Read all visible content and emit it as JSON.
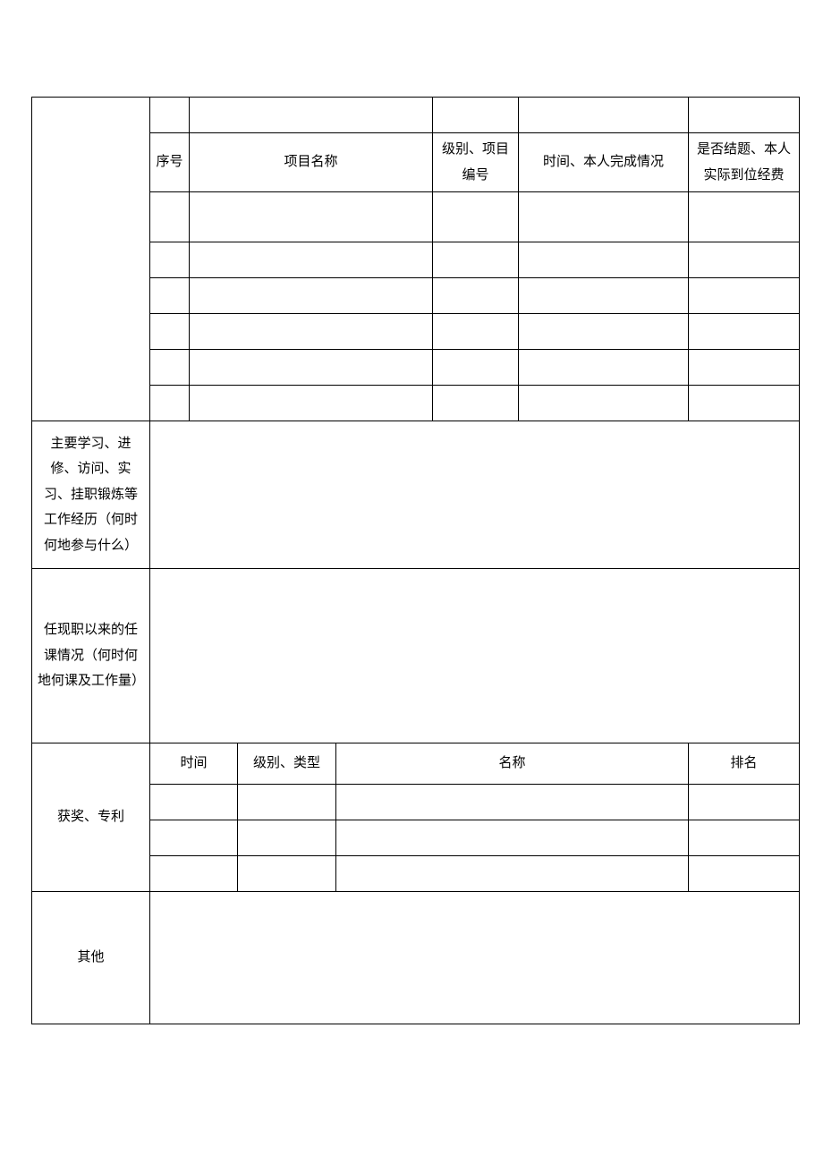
{
  "projects": {
    "headers": {
      "seq": "序号",
      "name": "项目名称",
      "level": "级别、项目编号",
      "status": "时间、本人完成情况",
      "funding": "是否结题、本人实际到位经费"
    }
  },
  "sections": {
    "study": "主要学习、进修、访问、实习、挂职锻炼等工作经历（何时何地参与什么）",
    "teaching": "任现职以来的任课情况（何时何地何课及工作量）",
    "awards": {
      "label": "获奖、专利",
      "time": "时间",
      "type": "级别、类型",
      "name": "名称",
      "rank": "排名"
    },
    "other": "其他"
  }
}
